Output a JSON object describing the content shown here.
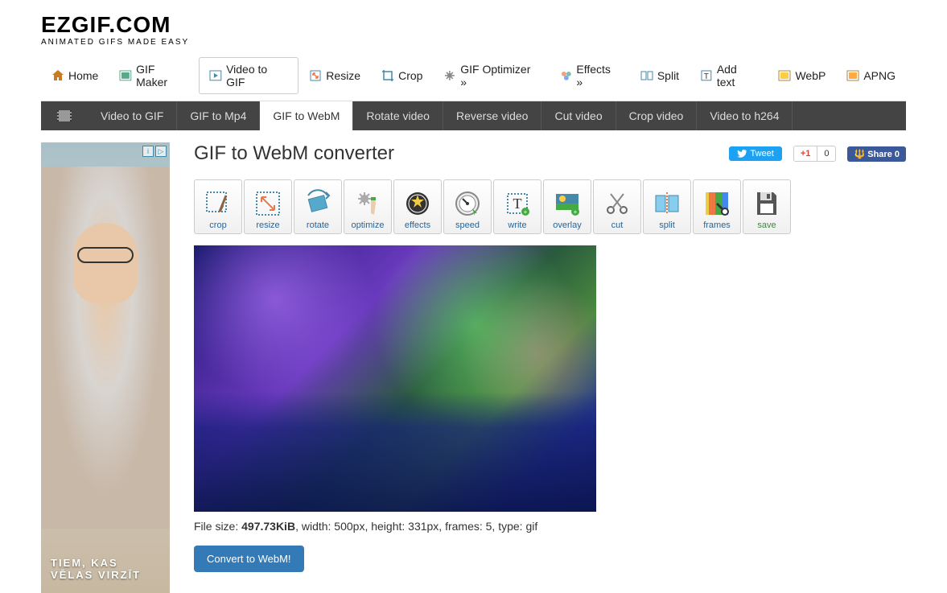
{
  "header": {
    "logo": "EZGIF.COM",
    "tagline": "ANIMATED GIFS MADE EASY"
  },
  "nav_main": [
    {
      "label": "Home",
      "icon": "home"
    },
    {
      "label": "GIF Maker",
      "icon": "gif"
    },
    {
      "label": "Video to GIF",
      "icon": "video",
      "active": true
    },
    {
      "label": "Resize",
      "icon": "resize"
    },
    {
      "label": "Crop",
      "icon": "crop"
    },
    {
      "label": "GIF Optimizer »",
      "icon": "optimize"
    },
    {
      "label": "Effects »",
      "icon": "effects"
    },
    {
      "label": "Split",
      "icon": "split"
    },
    {
      "label": "Add text",
      "icon": "text"
    },
    {
      "label": "WebP",
      "icon": "webp"
    },
    {
      "label": "APNG",
      "icon": "apng"
    }
  ],
  "nav_sub": [
    {
      "label": "Video to GIF"
    },
    {
      "label": "GIF to Mp4"
    },
    {
      "label": "GIF to WebM",
      "active": true
    },
    {
      "label": "Rotate video"
    },
    {
      "label": "Reverse video"
    },
    {
      "label": "Cut video"
    },
    {
      "label": "Crop video"
    },
    {
      "label": "Video to h264"
    }
  ],
  "page": {
    "title": "GIF to WebM converter"
  },
  "social": {
    "tweet": "Tweet",
    "gplus": "+1",
    "gplus_count": "0",
    "fb": "Share 0"
  },
  "tools": [
    {
      "label": "crop",
      "icon": "crop"
    },
    {
      "label": "resize",
      "icon": "resize"
    },
    {
      "label": "rotate",
      "icon": "rotate"
    },
    {
      "label": "optimize",
      "icon": "optimize"
    },
    {
      "label": "effects",
      "icon": "effects"
    },
    {
      "label": "speed",
      "icon": "speed"
    },
    {
      "label": "write",
      "icon": "write"
    },
    {
      "label": "overlay",
      "icon": "overlay"
    },
    {
      "label": "cut",
      "icon": "cut"
    },
    {
      "label": "split",
      "icon": "split"
    },
    {
      "label": "frames",
      "icon": "frames"
    },
    {
      "label": "save",
      "icon": "save",
      "class": "save"
    }
  ],
  "file_info": {
    "label": "File size: ",
    "size": "497.73KiB",
    "rest": ", width: 500px, height: 331px, frames: 5, type: gif"
  },
  "convert_button": "Convert to WebM!",
  "ad": {
    "text": "TIEM, KAS VĒLAS VIRZĪT"
  }
}
